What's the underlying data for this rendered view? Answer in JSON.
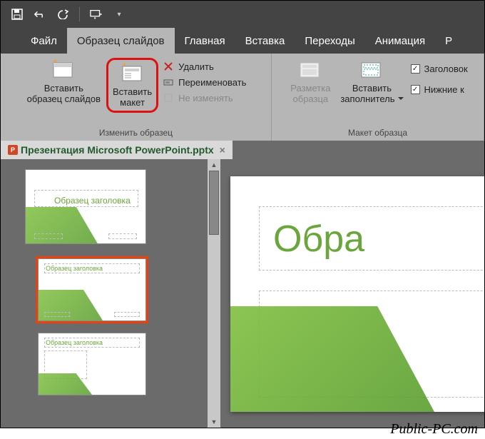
{
  "qat": {
    "save": "save-icon",
    "undo": "undo-icon",
    "redo": "redo-icon",
    "fromstart": "from-beginning-icon"
  },
  "tabs": {
    "file": "Файл",
    "slidemaster": "Образец слайдов",
    "home": "Главная",
    "insert": "Вставка",
    "transitions": "Переходы",
    "animations": "Анимация",
    "review_frag": "Р"
  },
  "ribbon": {
    "group_edit_master": "Изменить образец",
    "insert_slide_master_l1": "Вставить",
    "insert_slide_master_l2": "образец слайдов",
    "insert_layout_l1": "Вставить",
    "insert_layout_l2": "макет",
    "delete": "Удалить",
    "rename": "Переименовать",
    "preserve": "Не изменять",
    "group_master_layout": "Макет образца",
    "master_layout_l1": "Разметка",
    "master_layout_l2": "образца",
    "insert_placeholder_l1": "Вставить",
    "insert_placeholder_l2": "заполнитель",
    "chk_title": "Заголовок",
    "chk_footers": "Нижние к"
  },
  "doc": {
    "title": "Презентация Microsoft PowerPoint.pptx"
  },
  "thumbs": {
    "master_title": "Образец заголовка",
    "layout_title": "Образец заголовка"
  },
  "editor": {
    "title_fragment": "Обра"
  },
  "watermark": "Public-PC.com"
}
